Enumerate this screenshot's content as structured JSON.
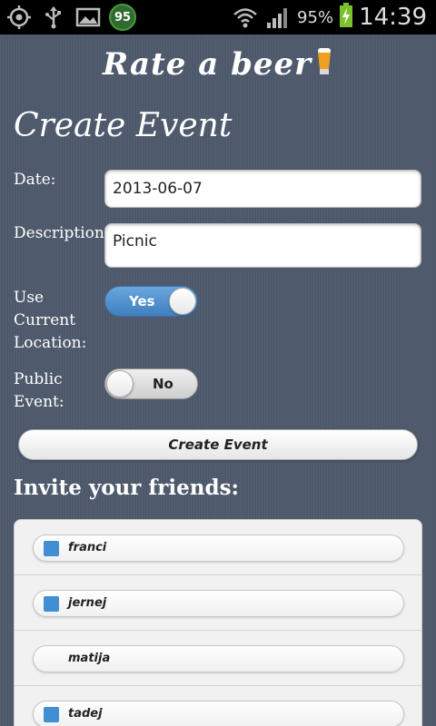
{
  "status_bar": {
    "icons": [
      "gps-icon",
      "usb-icon",
      "gallery-icon",
      "battery-widget-icon"
    ],
    "widget_badge": "95",
    "battery_percent": "95%",
    "time": "14:39"
  },
  "app": {
    "title": "Rate a beer"
  },
  "form": {
    "heading": "Create Event",
    "date_label": "Date:",
    "date_value": "2013-06-07",
    "description_label": "Description",
    "description_value": "Picnic",
    "location_label_1": "Use",
    "location_label_2": "Current",
    "location_label_3": "Location:",
    "location_toggle": "Yes",
    "public_label_1": "Public",
    "public_label_2": "Event:",
    "public_toggle": "No",
    "submit_label": "Create Event"
  },
  "friends": {
    "heading": "Invite your friends:",
    "items": [
      {
        "name": "franci",
        "checked": true
      },
      {
        "name": "jernej",
        "checked": true
      },
      {
        "name": "matija",
        "checked": false
      },
      {
        "name": "tadej",
        "checked": true
      }
    ]
  },
  "colors": {
    "background": "#4f5b6d",
    "toggle_on": "#3f7fc0",
    "checkbox": "#3f8fd2"
  }
}
